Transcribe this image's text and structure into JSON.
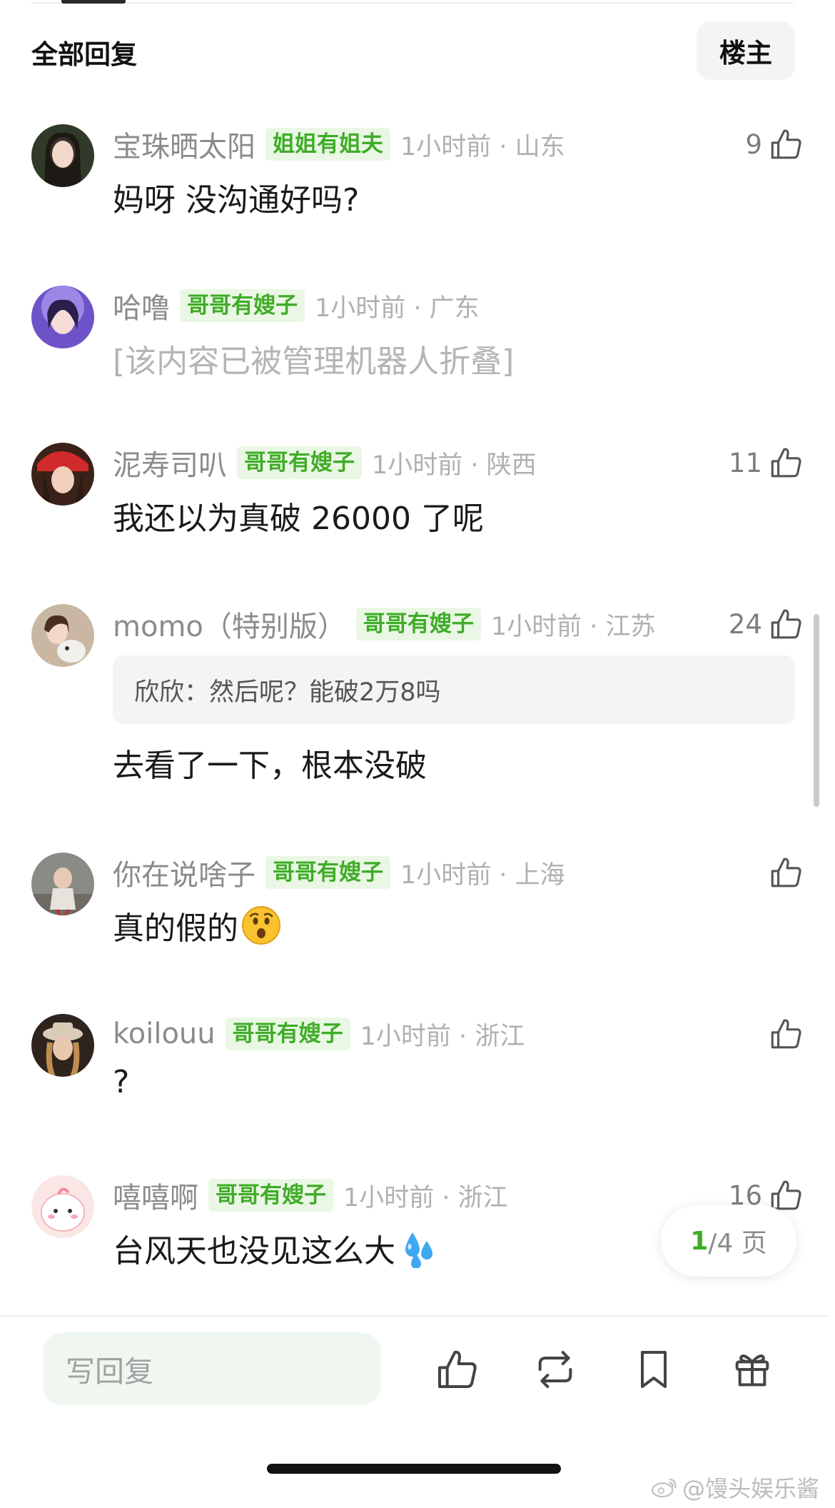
{
  "header": {
    "title": "全部回复",
    "op_label": "楼主"
  },
  "comments": [
    {
      "username": "宝珠晒太阳",
      "badge": "姐姐有姐夫",
      "meta": "1小时前 · 山东",
      "likes": "9",
      "text": "妈呀 没沟通好吗?"
    },
    {
      "username": "哈噜",
      "badge": "哥哥有嫂子",
      "meta": "1小时前 · 广东",
      "likes": "",
      "text": "[该内容已被管理机器人折叠]"
    },
    {
      "username": "泥寿司叭",
      "badge": "哥哥有嫂子",
      "meta": "1小时前 · 陕西",
      "likes": "11",
      "text": "我还以为真破 26000 了呢"
    },
    {
      "username": "momo（特别版）",
      "badge": "哥哥有嫂子",
      "meta": "1小时前 · 江苏",
      "likes": "24",
      "quote": "欣欣：然后呢？能破2万8吗",
      "text": "去看了一下，根本没破"
    },
    {
      "username": "你在说啥子",
      "badge": "哥哥有嫂子",
      "meta": "1小时前 · 上海",
      "likes": "",
      "text": "真的假的"
    },
    {
      "username": "koilouu",
      "badge": "哥哥有嫂子",
      "meta": "1小时前 · 浙江",
      "likes": "",
      "text": "?"
    },
    {
      "username": "嘻嘻啊",
      "badge": "哥哥有嫂子",
      "meta": "1小时前 · 浙江",
      "likes": "16",
      "text": "台风天也没见这么大"
    }
  ],
  "pager": {
    "current": "1",
    "rest": "/4 页"
  },
  "footer": {
    "reply_placeholder": "写回复"
  },
  "icons": [
    "thumbs-up-icon",
    "repost-icon",
    "bookmark-icon",
    "gift-icon",
    "weibo-icon"
  ],
  "watermark": "@馒头娱乐酱",
  "colors": {
    "badge_green": "#3fac28",
    "badge_bg": "#eaf7e4",
    "input_bg": "#eff7f0"
  }
}
